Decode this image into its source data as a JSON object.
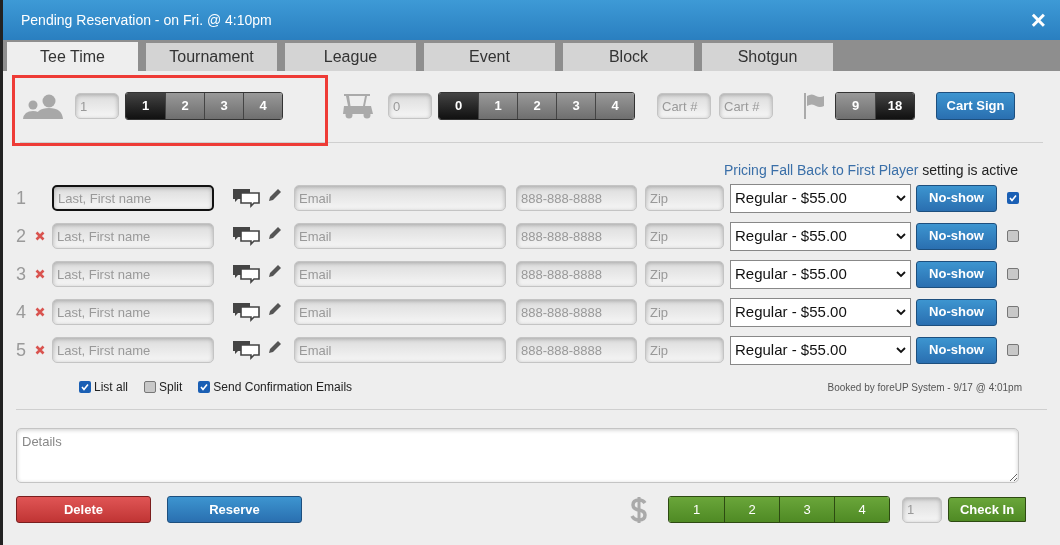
{
  "window": {
    "title": "Pending Reservation - on Fri. @ 4:10pm",
    "close": "×"
  },
  "tabs": [
    {
      "label": "Tee Time",
      "selected": true
    },
    {
      "label": "Tournament",
      "selected": false
    },
    {
      "label": "League",
      "selected": false
    },
    {
      "label": "Event",
      "selected": false
    },
    {
      "label": "Block",
      "selected": false
    },
    {
      "label": "Shotgun",
      "selected": false
    }
  ],
  "players": {
    "count_placeholder": "1",
    "options": [
      {
        "label": "1",
        "selected": true
      },
      {
        "label": "2",
        "selected": false
      },
      {
        "label": "3",
        "selected": false
      },
      {
        "label": "4",
        "selected": false
      }
    ],
    "highlighted": true
  },
  "carts": {
    "count_placeholder": "0",
    "options": [
      {
        "label": "0",
        "selected": true
      },
      {
        "label": "1",
        "selected": false
      },
      {
        "label": "2",
        "selected": false
      },
      {
        "label": "3",
        "selected": false
      },
      {
        "label": "4",
        "selected": false
      }
    ],
    "cart_number_placeholders": [
      "Cart #",
      "Cart #"
    ]
  },
  "holes": {
    "options": [
      {
        "label": "9",
        "selected": false
      },
      {
        "label": "18",
        "selected": true
      }
    ]
  },
  "cart_sign_button": "Cart Sign",
  "pricing_note": {
    "link": "Pricing Fall Back to First Player",
    "text": "setting is active"
  },
  "player_rows": [
    {
      "number": "1",
      "removable": false,
      "focused": true,
      "name_placeholder": "Last, First name",
      "email_placeholder": "Email",
      "phone_placeholder": "888-888-8888",
      "zip_placeholder": "Zip",
      "price": "Regular - $55.00",
      "no_show": "No-show",
      "checked": true
    },
    {
      "number": "2",
      "removable": true,
      "focused": false,
      "name_placeholder": "Last, First name",
      "email_placeholder": "Email",
      "phone_placeholder": "888-888-8888",
      "zip_placeholder": "Zip",
      "price": "Regular - $55.00",
      "no_show": "No-show",
      "checked": false
    },
    {
      "number": "3",
      "removable": true,
      "focused": false,
      "name_placeholder": "Last, First name",
      "email_placeholder": "Email",
      "phone_placeholder": "888-888-8888",
      "zip_placeholder": "Zip",
      "price": "Regular - $55.00",
      "no_show": "No-show",
      "checked": false
    },
    {
      "number": "4",
      "removable": true,
      "focused": false,
      "name_placeholder": "Last, First name",
      "email_placeholder": "Email",
      "phone_placeholder": "888-888-8888",
      "zip_placeholder": "Zip",
      "price": "Regular - $55.00",
      "no_show": "No-show",
      "checked": false
    },
    {
      "number": "5",
      "removable": true,
      "focused": false,
      "name_placeholder": "Last, First name",
      "email_placeholder": "Email",
      "phone_placeholder": "888-888-8888",
      "zip_placeholder": "Zip",
      "price": "Regular - $55.00",
      "no_show": "No-show",
      "checked": false
    }
  ],
  "options": [
    {
      "label": "List all",
      "checked": true
    },
    {
      "label": "Split",
      "checked": false
    },
    {
      "label": "Send Confirmation Emails",
      "checked": true
    }
  ],
  "booked_by": "Booked by foreUP System - 9/17 @ 4:01pm",
  "details_placeholder": "Details",
  "delete_button": "Delete",
  "reserve_button": "Reserve",
  "pay_buttons": [
    "1",
    "2",
    "3",
    "4"
  ],
  "check_in": {
    "count_placeholder": "1",
    "button": "Check In"
  }
}
